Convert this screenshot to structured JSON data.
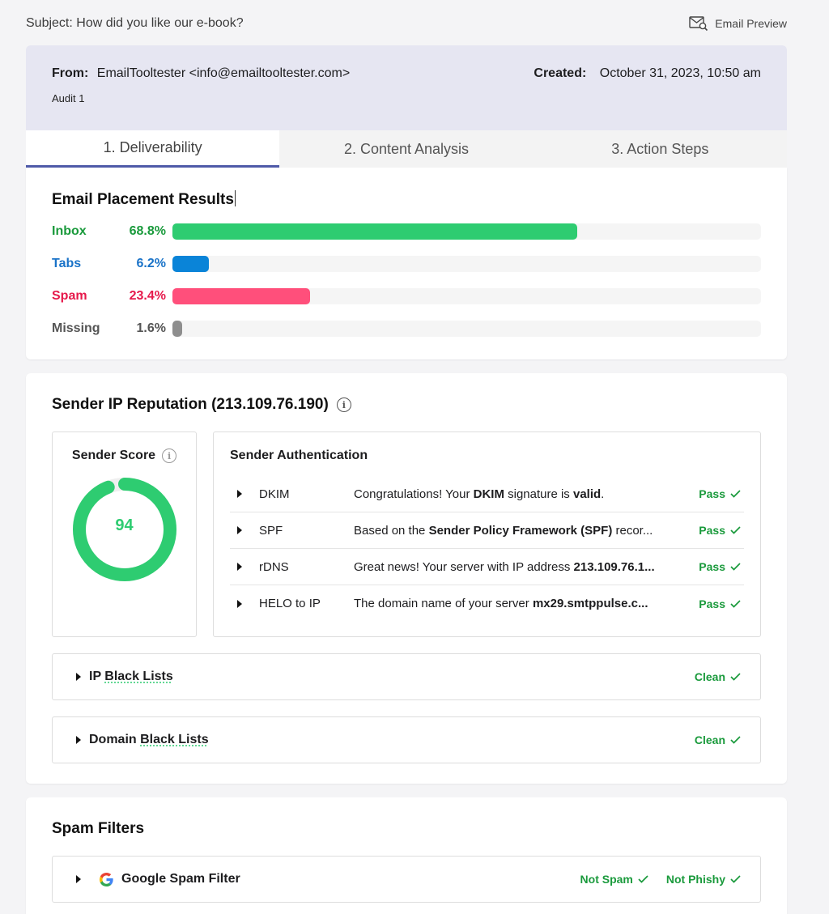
{
  "subject": "Subject: How did you like our e-book?",
  "preview_label": "Email Preview",
  "header": {
    "from_label": "From:",
    "from_value": "EmailTooltester <info@emailtooltester.com>",
    "created_label": "Created:",
    "created_value": "October 31, 2023, 10:50 am",
    "audit": "Audit 1"
  },
  "tabs": [
    {
      "label": "1. Deliverability",
      "active": true
    },
    {
      "label": "2. Content Analysis",
      "active": false
    },
    {
      "label": "3. Action Steps",
      "active": false
    }
  ],
  "placement": {
    "title": "Email Placement Results",
    "rows": [
      {
        "label": "Inbox",
        "pct_text": "68.8%",
        "value": 68.8,
        "color": "#2ecc71",
        "label_color": "#1a9a3c"
      },
      {
        "label": "Tabs",
        "pct_text": "6.2%",
        "value": 6.2,
        "color": "#0a84d8",
        "label_color": "#1a73c8"
      },
      {
        "label": "Spam",
        "pct_text": "23.4%",
        "value": 23.4,
        "color": "#ff4f7b",
        "label_color": "#e6194b"
      },
      {
        "label": "Missing",
        "pct_text": "1.6%",
        "value": 1.6,
        "color": "#8e8e8e",
        "label_color": "#555555"
      }
    ]
  },
  "reputation": {
    "title": "Sender IP Reputation (213.109.76.190)",
    "score_title": "Sender Score",
    "score": "94",
    "score_value": 94,
    "auth_title": "Sender Authentication",
    "auth_rows": [
      {
        "name": "DKIM",
        "pre": "Congratulations! Your ",
        "b1": "DKIM",
        "mid": " signature is ",
        "b2": "valid",
        "post": ".",
        "status": "Pass"
      },
      {
        "name": "SPF",
        "pre": "Based on the ",
        "b1": "Sender Policy Framework (SPF)",
        "mid": " recor...",
        "b2": "",
        "post": "",
        "status": "Pass"
      },
      {
        "name": "rDNS",
        "pre": "Great news! Your server with IP address ",
        "b1": "213.109.76.1...",
        "mid": "",
        "b2": "",
        "post": "",
        "status": "Pass"
      },
      {
        "name": "HELO to IP",
        "pre": "The domain name of your server ",
        "b1": "mx29.smtppulse.c...",
        "mid": "",
        "b2": "",
        "post": "",
        "status": "Pass"
      }
    ],
    "ip_blacklists": {
      "prefix": "IP ",
      "squiggle": "Black Lists",
      "status": "Clean"
    },
    "domain_blacklists": {
      "prefix": "Domain ",
      "squiggle": "Black Lists",
      "status": "Clean"
    }
  },
  "spam_filters": {
    "title": "Spam Filters",
    "google": {
      "label": "Google Spam Filter",
      "status1": "Not Spam",
      "status2": "Not Phishy"
    }
  },
  "icons": {
    "preview": "envelope-search-icon",
    "info": "info-icon",
    "check": "check-icon",
    "expand": "triangle-right-icon",
    "google": "google-g-icon"
  }
}
